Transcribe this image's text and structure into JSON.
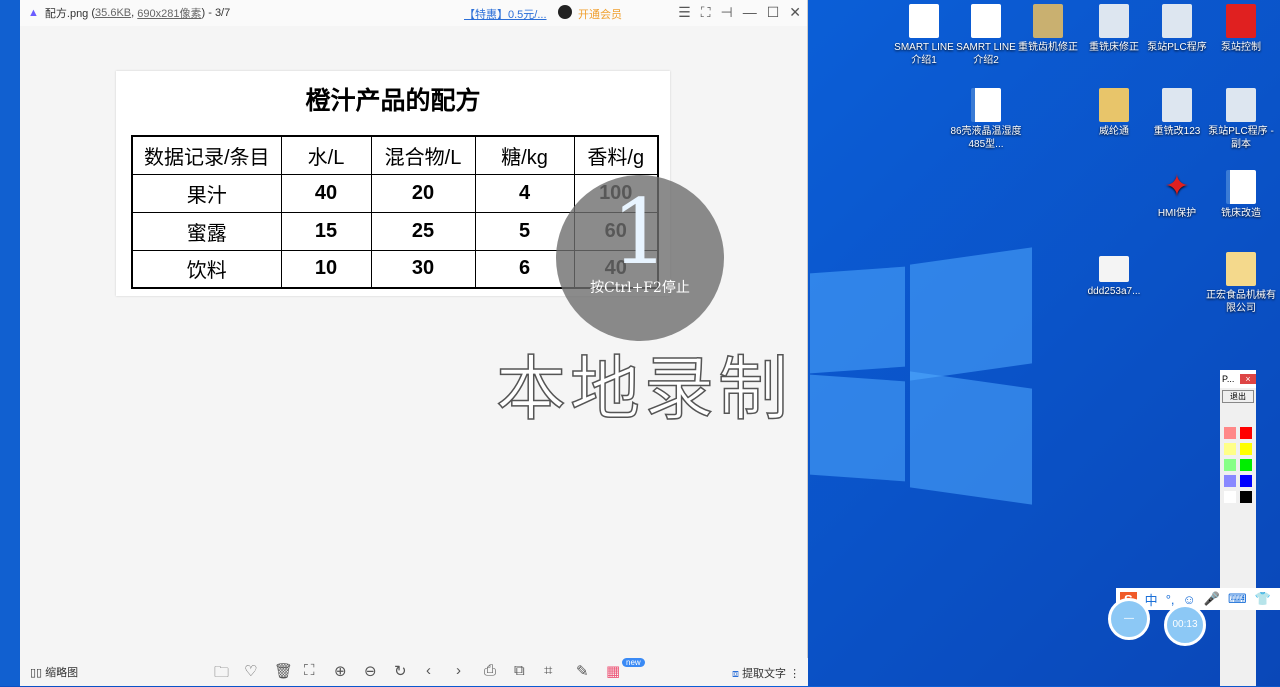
{
  "viewer": {
    "app_icon": "photo-viewer-icon",
    "filename": "配方.png",
    "filesize": "35.6KB",
    "dimensions": "690x281像素",
    "position": "3/7",
    "promo": "【特惠】0.5元/...",
    "vip": "开通会员",
    "window_controls": [
      "menu",
      "fullscreen",
      "pin",
      "minimize",
      "maximize",
      "close"
    ]
  },
  "image": {
    "title": "橙汁产品的配方",
    "headers": [
      "数据记录/条目",
      "水/L",
      "混合物/L",
      "糖/kg",
      "香料/g"
    ],
    "rows": [
      [
        "果汁",
        "40",
        "20",
        "4",
        "100"
      ],
      [
        "蜜露",
        "15",
        "25",
        "5",
        "60"
      ],
      [
        "饮料",
        "10",
        "30",
        "6",
        "40"
      ]
    ]
  },
  "overlay": {
    "countdown": "1",
    "hint": "按Ctrl+F2停止",
    "watermark": "本地录制"
  },
  "bottom": {
    "thumbnails": "缩略图",
    "new_badge": "new",
    "extract_text": "提取文字"
  },
  "desktop": {
    "icons": [
      "SMART LINE 介绍1",
      "SAMRT LINE 介绍2",
      "重铣齿机修正",
      "重铣床修正",
      "泵站PLC程序",
      "泵站控制",
      "86壳液晶温湿度485型...",
      "威纶通",
      "重铣改123",
      "泵站PLC程序 - 副本",
      "HMI保护",
      "铣床改造",
      "ddd253a7...",
      "正宏食品机械有限公司"
    ]
  },
  "pen_tool": {
    "title": "P...",
    "exit": "退出"
  },
  "ime": {
    "mode": "中",
    "punct": "°,"
  },
  "timer": {
    "elapsed": "00:13"
  },
  "colors": {
    "accent": "#2b6fd8",
    "desktop": "#0b5fd8"
  }
}
